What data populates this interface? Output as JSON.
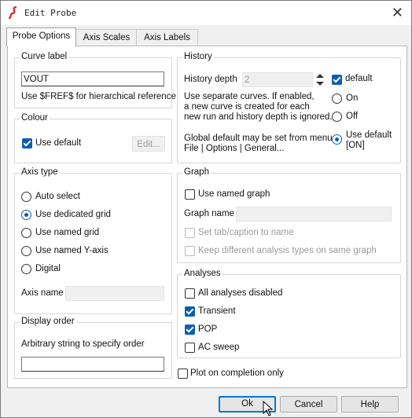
{
  "window": {
    "title": "Edit Probe",
    "close_glyph": "✕"
  },
  "tabs": [
    {
      "label": "Probe Options",
      "active": true
    },
    {
      "label": "Axis Scales",
      "active": false
    },
    {
      "label": "Axis Labels",
      "active": false
    }
  ],
  "curve_label": {
    "title": "Curve label",
    "value": "VOUT",
    "hint": "Use $FREF$ for hierarchical reference"
  },
  "colour": {
    "title": "Colour",
    "use_default_label": "Use default",
    "use_default_checked": true,
    "edit_button": "Edit..."
  },
  "axis_type": {
    "title": "Axis type",
    "options": [
      {
        "label": "Auto select",
        "checked": false
      },
      {
        "label": "Use dedicated grid",
        "checked": true
      },
      {
        "label": "Use named grid",
        "checked": false
      },
      {
        "label": "Use named Y-axis",
        "checked": false
      },
      {
        "label": "Digital",
        "checked": false
      }
    ],
    "axis_name_label": "Axis name",
    "axis_name_value": ""
  },
  "display_order": {
    "title": "Display order",
    "description": "Arbitrary string to specify order",
    "value": ""
  },
  "history": {
    "title": "History",
    "depth_label": "History depth",
    "depth_value": "2",
    "default_label": "default",
    "default_checked": true,
    "separate_text_1": "Use separate curves. If enabled,",
    "separate_text_2": "a new curve is created for each",
    "separate_text_3": "new run and history depth is ignored.",
    "on_label": "On",
    "off_label": "Off",
    "global_text_1": "Global default may be set from menu",
    "global_text_2": "File | Options | General...",
    "use_default_label_1": "Use default",
    "use_default_label_2": "[ON]",
    "selected": "use_default"
  },
  "graph": {
    "title": "Graph",
    "use_named_graph_label": "Use named graph",
    "use_named_graph_checked": false,
    "graph_name_label": "Graph name",
    "graph_name_value": "",
    "set_tab_label": "Set tab/caption to name",
    "keep_different_label": "Keep different analysis types on same graph"
  },
  "analyses": {
    "title": "Analyses",
    "items": [
      {
        "label": "All analyses disabled",
        "checked": false
      },
      {
        "label": "Transient",
        "checked": true
      },
      {
        "label": "POP",
        "checked": true
      },
      {
        "label": "AC sweep",
        "checked": false
      }
    ]
  },
  "plot_on_completion": {
    "label": "Plot on completion only",
    "checked": false
  },
  "buttons": {
    "ok": "Ok",
    "cancel": "Cancel",
    "help": "Help"
  },
  "colors": {
    "accent": "#0a5fb4",
    "focus": "#0078d4",
    "logo": "#d42020"
  }
}
